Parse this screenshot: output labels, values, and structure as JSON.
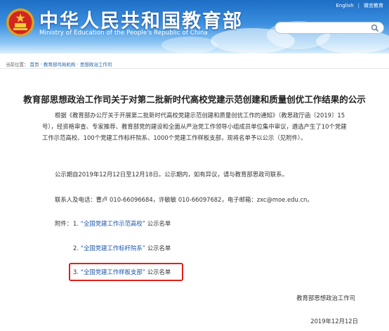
{
  "header": {
    "site_title": "中华人民共和国教育部",
    "site_subtitle": "Ministry of Education of the People's Republic of China",
    "top_links": [
      "English",
      "|",
      "微言教育"
    ],
    "search_placeholder": ""
  },
  "breadcrumb": {
    "label": "当前位置：",
    "items": [
      "首页",
      "教育部司局机构",
      "思想政治工作司"
    ]
  },
  "article": {
    "title": "教育部思想政治工作司关于对第二批新时代高校党建示范创建和质量创优工作结果的公示",
    "paragraph_1": "根据《教育部办公厅关于开展第二批新时代高校党建示范创建和质量创优工作的通知》（教思政厅函〔2019〕15号），经资格审查、专家推荐、教育部党的建设和全面从严治党工作领导小组成员单位集中审议，遴选产生了10个党建工作示范高校、100个党建工作标杆院系、1000个党建工作样板支部，现将名单予以公示（见附件）。",
    "paragraph_2": "公示期自2019年12月12日至12月18日。公示期内，如有异议，请与教育部思政司联系。",
    "paragraph_3": "联系人及电话：曹卢 010-66096684，许敏敏 010-66097682，电子邮箱：zxc@moe.edu.cn。",
    "attachments_label": "附件：",
    "attachments": [
      {
        "num": "1.",
        "link": "“全国党建工作示范高校”",
        "suffix": "公示名单"
      },
      {
        "num": "2.",
        "link": "“全国党建工作标杆院系”",
        "suffix": "公示名单"
      },
      {
        "num": "3.",
        "link": "“全国党建工作样板支部”",
        "suffix": "公示名单"
      }
    ],
    "signature": "教育部思想政治工作司",
    "date": "2019年12月12日"
  },
  "colors": {
    "header_blue": "#1d6ec4",
    "link_blue": "#1a55a8",
    "highlight_red": "#e0201b"
  }
}
